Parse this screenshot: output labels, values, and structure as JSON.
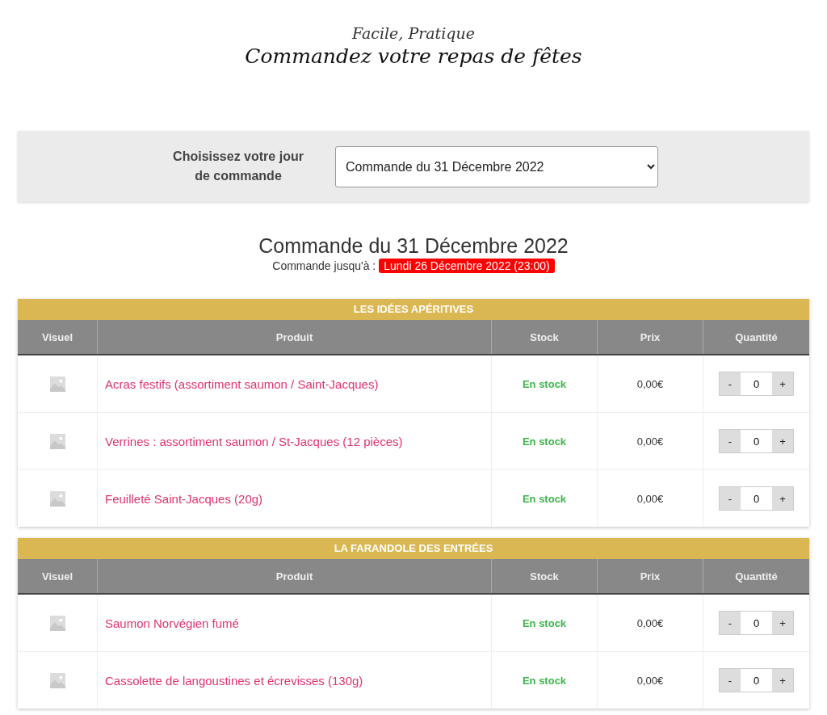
{
  "header": {
    "tagline": "Facile, Pratique",
    "title": "Commandez votre repas de fêtes"
  },
  "day_picker": {
    "label": "Choisissez votre jour de commande",
    "value": "Commande du 31 Décembre 2022"
  },
  "order": {
    "title": "Commande du 31 Décembre 2022",
    "deadline_label": "Commande jusqu'à :",
    "deadline": "Lundi 26 Décembre 2022 (23:00)"
  },
  "sections": [
    {
      "title": "LES IDÉES APÉRITIVES",
      "columns": [
        "Visuel",
        "Produit",
        "Stock",
        "Prix",
        "Quantité"
      ],
      "rows": [
        {
          "product": "Acras festifs (assortiment saumon / Saint-Jacques)",
          "stock": "En stock",
          "price": "0,00€",
          "decrement": "-",
          "quantity": "0",
          "increment": "+"
        },
        {
          "product": "Verrines : assortiment saumon / St-Jacques (12 pièces)",
          "stock": "En stock",
          "price": "0,00€",
          "decrement": "-",
          "quantity": "0",
          "increment": "+"
        },
        {
          "product": "Feuilleté Saint-Jacques (20g)",
          "stock": "En stock",
          "price": "0,00€",
          "decrement": "-",
          "quantity": "0",
          "increment": "+"
        }
      ]
    },
    {
      "title": "LA FARANDOLE DES ENTRÉES",
      "columns": [
        "Visuel",
        "Produit",
        "Stock",
        "Prix",
        "Quantité"
      ],
      "rows": [
        {
          "product": "Saumon Norvégien fumé",
          "stock": "En stock",
          "price": "0,00€",
          "decrement": "-",
          "quantity": "0",
          "increment": "+"
        },
        {
          "product": "Cassolette de langoustines et écrevisses (130g)",
          "stock": "En stock",
          "price": "0,00€",
          "decrement": "-",
          "quantity": "0",
          "increment": "+"
        }
      ]
    }
  ]
}
